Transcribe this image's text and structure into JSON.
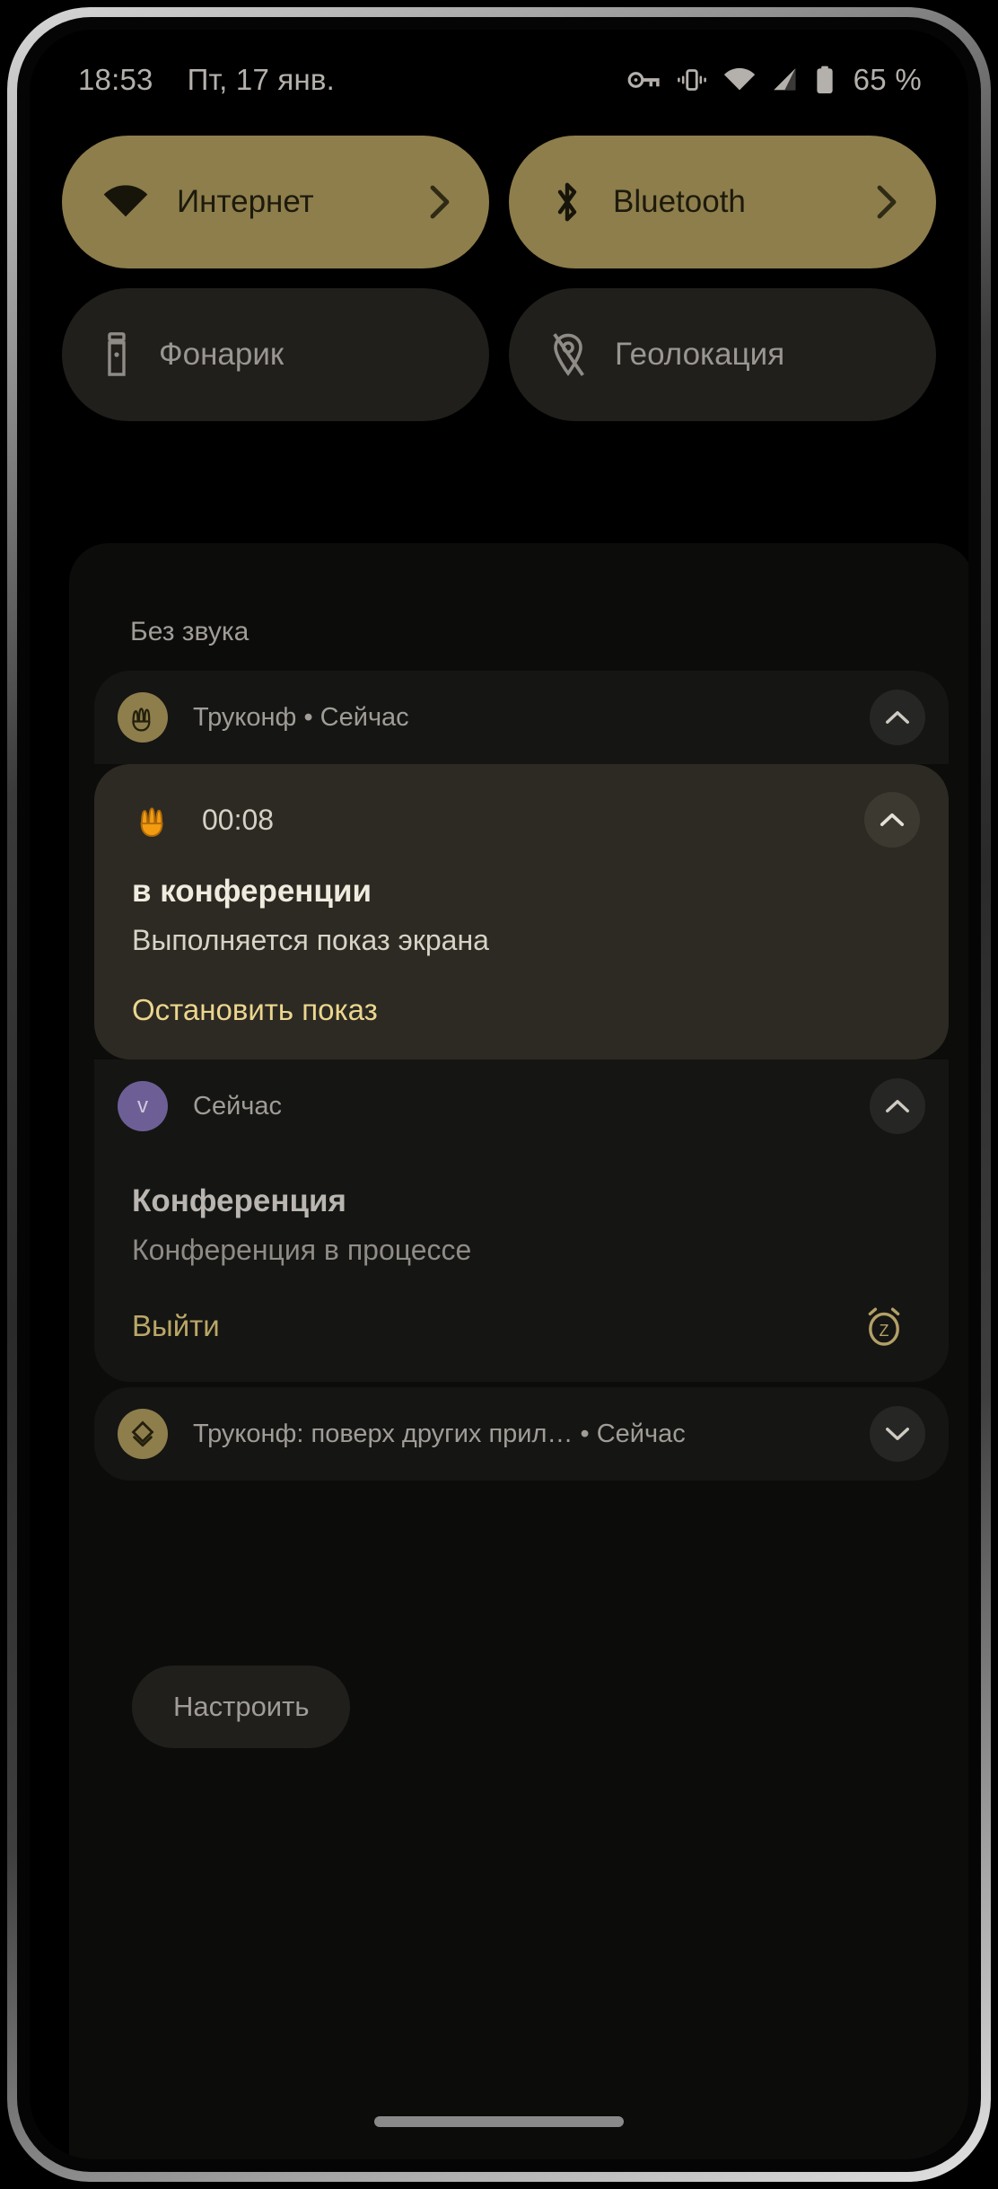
{
  "status_bar": {
    "time": "18:53",
    "date": "Пт, 17 янв.",
    "icons": [
      "vpn-key-icon",
      "vibrate-icon",
      "wifi-icon",
      "signal-icon",
      "battery-icon"
    ],
    "battery_text": "65 %"
  },
  "quick_settings": {
    "tiles": [
      {
        "label": "Интернет",
        "icon": "wifi-icon",
        "state": "active",
        "has_chevron": true
      },
      {
        "label": "Bluetooth",
        "icon": "bluetooth-icon",
        "state": "active",
        "has_chevron": true
      },
      {
        "label": "Фонарик",
        "icon": "flashlight-icon",
        "state": "inactive",
        "has_chevron": false
      },
      {
        "label": "Геолокация",
        "icon": "location-off-icon",
        "state": "inactive",
        "has_chevron": false
      }
    ]
  },
  "shade": {
    "section_header": "Без звука",
    "settings_button": "Настроить",
    "notifications": [
      {
        "group_header": {
          "app": "Труконф",
          "separator": "•",
          "time": "Сейчас",
          "title_line": "Труконф • Сейчас",
          "avatar": "truconf-people-icon",
          "chevron": "chevron-up-icon"
        },
        "card": {
          "timer": "00:08",
          "icon": "people-orange-icon",
          "title": "в конференции",
          "body": "Выполняется показ экрана",
          "action": "Остановить показ",
          "chevron": "chevron-up-icon"
        }
      },
      {
        "group_header": {
          "time": "Сейчас",
          "title_line": "Сейчас",
          "avatar_letter": "v",
          "chevron": "chevron-up-icon"
        },
        "card": {
          "title": "Конференция",
          "body": "Конференция в процессе",
          "action": "Выйти",
          "snooze_icon": "snooze-alarm-icon"
        }
      },
      {
        "row": {
          "title_line": "Труконф: поверх других прил…  •  Сейчас",
          "avatar": "overlay-diamond-icon",
          "chevron": "chevron-down-icon"
        }
      }
    ]
  },
  "colors": {
    "tile_active": "#8d7e4c",
    "tile_inactive": "#201f1c",
    "accent_gold": "#ecd68e",
    "accent_orange": "#f39c12",
    "avatar_purple": "#6d5f96",
    "card_highlight": "#2c2a23",
    "shade_bg": "#0c0c0b"
  },
  "nav": {
    "gesture_bar": "home-gesture-bar"
  }
}
